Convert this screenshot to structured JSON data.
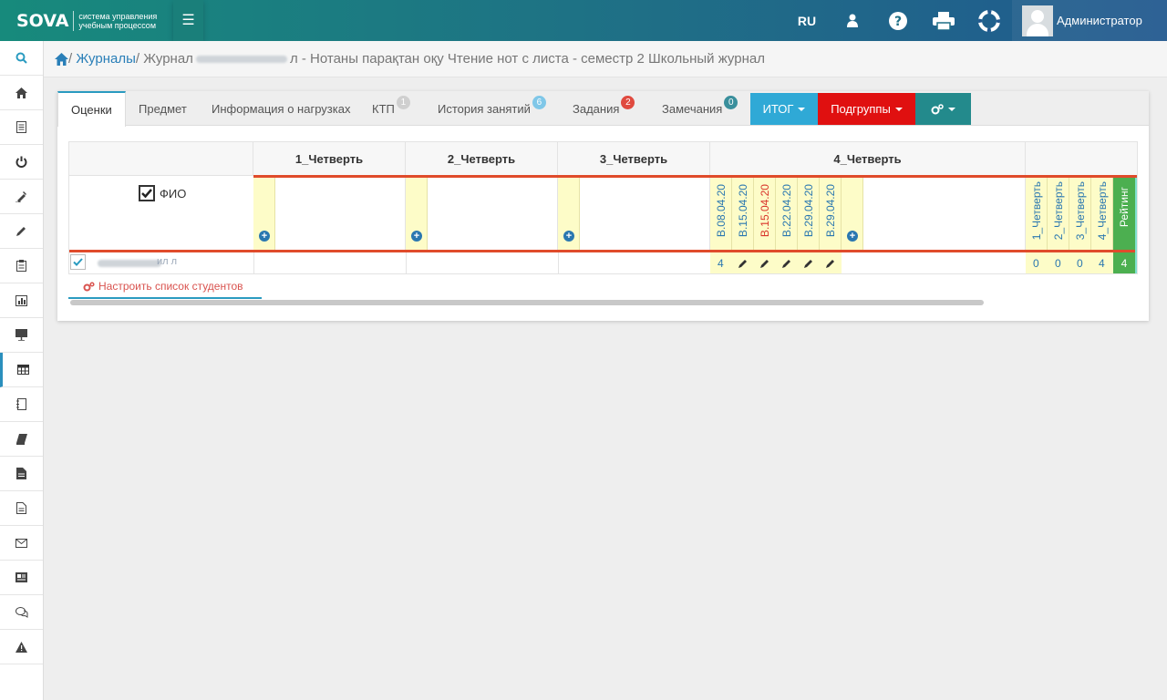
{
  "topbar": {
    "logo_mark": "SOVA",
    "logo_sub": "система управления учебным процессом",
    "lang": "RU",
    "user_name": "Администратор"
  },
  "breadcrumb": {
    "home_icon": "home-icon",
    "journals": "Журналы",
    "journal_prefix": "Журнал",
    "journal_suffix": "л - Нотаны парақтан оқу Чтение нот с листа - семестр 2 Школьный журнал"
  },
  "tabs": {
    "grades": "Оценки",
    "subject": "Предмет",
    "load_info": "Информация о нагрузках",
    "ktp": "КТП",
    "ktp_badge": "1",
    "history": "История занятий",
    "history_badge": "6",
    "tasks": "Задания",
    "tasks_badge": "2",
    "remarks": "Замечания",
    "remarks_badge": "0",
    "total_btn": "ИТОГ",
    "subgroups_btn": "Подгруппы"
  },
  "colors": {
    "accent": "#2a9bc0",
    "itog": "#2fa9d6",
    "subgroups": "#e01010",
    "settings": "#238a8c",
    "rating": "#4caf50",
    "highlight": "#fdfcc8"
  },
  "grid": {
    "quarters": [
      "1_Четверть",
      "2_Четверть",
      "3_Четверть",
      "4_Четверть"
    ],
    "fio_label": "ФИО",
    "dates": [
      {
        "label": "В.08.04.20",
        "red": false
      },
      {
        "label": "В.15.04.20",
        "red": false
      },
      {
        "label": "В.15.04.20",
        "red": true
      },
      {
        "label": "В.22.04.20",
        "red": false
      },
      {
        "label": "В.29.04.20",
        "red": false
      },
      {
        "label": "В.29.04.20",
        "red": false
      }
    ],
    "summary_cols": [
      "1_Четверть",
      "2_Четверть",
      "3_Четверть",
      "4_Четверть"
    ],
    "rating_label": "Рейтинг",
    "student_name_visible": "ил л",
    "first_grade": "4",
    "summary_values": [
      "0",
      "0",
      "0",
      "4"
    ],
    "rating_value": "4",
    "configure_link": "Настроить список студентов"
  },
  "icons": {
    "search": "search-icon",
    "home": "home-icon",
    "user": "user-icon",
    "help": "question-icon",
    "print": "print-icon",
    "support": "lifebuoy-icon"
  }
}
